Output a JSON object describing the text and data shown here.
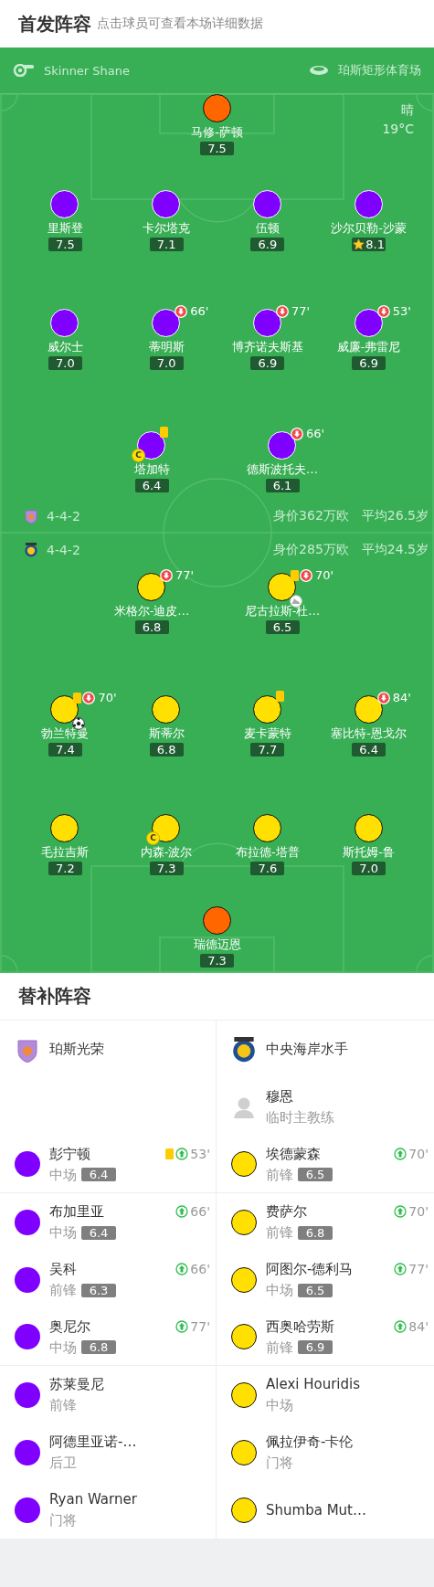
{
  "header": {
    "title": "首发阵容",
    "subtitle": "点击球员可查看本场详细数据"
  },
  "match": {
    "referee": "Skinner Shane",
    "venue": "珀斯矩形体育场",
    "weather": "晴",
    "temperature": "19°C"
  },
  "lineups": [
    {
      "formation": "4-4-2",
      "market_value": "身价362万欧",
      "average_age": "平均26.5岁",
      "lines": [
        [
          {
            "name": "马修-萨顿",
            "rating": "7.5",
            "color": "#ff6600",
            "best": false,
            "yellow_card": false,
            "goal": false,
            "assist": false
          }
        ],
        [
          {
            "name": "里斯登",
            "rating": "7.5",
            "color": "#8000ff",
            "best": false,
            "yellow_card": false,
            "goal": false,
            "assist": false
          },
          {
            "name": "卡尔塔克",
            "rating": "7.1",
            "color": "#8000ff",
            "best": false,
            "yellow_card": false,
            "goal": false,
            "assist": false
          },
          {
            "name": "伍顿",
            "rating": "6.9",
            "color": "#8000ff",
            "best": false,
            "yellow_card": false,
            "goal": false,
            "assist": false
          },
          {
            "name": "沙尔贝勒-沙蒙",
            "rating": "8.1",
            "color": "#8000ff",
            "best": true,
            "yellow_card": false,
            "goal": false,
            "assist": false
          }
        ],
        [
          {
            "name": "威尔士",
            "rating": "7.0",
            "color": "#8000ff",
            "best": false,
            "yellow_card": false,
            "goal": false,
            "assist": false
          },
          {
            "name": "蒂明斯",
            "rating": "7.0",
            "color": "#8000ff",
            "best": false,
            "yellow_card": false,
            "goal": false,
            "assist": false,
            "substituted_out": "66'"
          },
          {
            "name": "博齐诺夫斯基",
            "rating": "6.9",
            "color": "#8000ff",
            "best": false,
            "yellow_card": false,
            "goal": false,
            "assist": false,
            "substituted_out": "77'"
          },
          {
            "name": "威廉-弗雷尼",
            "rating": "6.9",
            "color": "#8000ff",
            "best": false,
            "yellow_card": false,
            "goal": false,
            "assist": false,
            "substituted_out": "53'"
          }
        ],
        [
          {
            "name": "塔加特",
            "rating": "6.4",
            "color": "#8000ff",
            "best": false,
            "yellow_card": true,
            "goal": false,
            "assist": false,
            "captain": "C"
          },
          {
            "name": "德斯波托夫…",
            "rating": "6.1",
            "color": "#8000ff",
            "best": false,
            "yellow_card": false,
            "goal": false,
            "assist": false,
            "substituted_out": "66'"
          }
        ]
      ]
    },
    {
      "formation": "4-4-2",
      "market_value": "身价285万欧",
      "average_age": "平均24.5岁",
      "lines": [
        [
          {
            "name": "米格尔-迪皮…",
            "rating": "6.8",
            "color": "#ffe000",
            "best": false,
            "yellow_card": false,
            "goal": false,
            "assist": false,
            "substituted_out": "77'"
          },
          {
            "name": "尼古拉斯-杜…",
            "rating": "6.5",
            "color": "#ffe000",
            "best": false,
            "yellow_card": true,
            "goal": false,
            "assist": true,
            "substituted_out": "70'"
          }
        ],
        [
          {
            "name": "勃兰特曼",
            "rating": "7.4",
            "color": "#ffe000",
            "best": false,
            "yellow_card": true,
            "goal": true,
            "assist": false,
            "substituted_out": "70'"
          },
          {
            "name": "斯蒂尔",
            "rating": "6.8",
            "color": "#ffe000",
            "best": false,
            "yellow_card": false,
            "goal": false,
            "assist": false
          },
          {
            "name": "麦卡蒙特",
            "rating": "7.7",
            "color": "#ffe000",
            "best": false,
            "yellow_card": true,
            "goal": false,
            "assist": false
          },
          {
            "name": "塞比特-恩戈尔",
            "rating": "6.4",
            "color": "#ffe000",
            "best": false,
            "yellow_card": false,
            "goal": false,
            "assist": false,
            "substituted_out": "84'"
          }
        ],
        [
          {
            "name": "毛拉吉斯",
            "rating": "7.2",
            "color": "#ffe000",
            "best": false,
            "yellow_card": false,
            "goal": false,
            "assist": false
          },
          {
            "name": "内森-波尔",
            "rating": "7.3",
            "color": "#ffe000",
            "best": false,
            "yellow_card": false,
            "goal": false,
            "assist": false,
            "captain": "C"
          },
          {
            "name": "布拉德-塔普",
            "rating": "7.6",
            "color": "#ffe000",
            "best": false,
            "yellow_card": false,
            "goal": false,
            "assist": false
          },
          {
            "name": "斯托姆-鲁",
            "rating": "7.0",
            "color": "#ffe000",
            "best": false,
            "yellow_card": false,
            "goal": false,
            "assist": false
          }
        ],
        [
          {
            "name": "瑞德迈恩",
            "rating": "7.3",
            "color": "#ff6600",
            "best": false,
            "yellow_card": false,
            "goal": false,
            "assist": false
          }
        ]
      ]
    }
  ],
  "bench": {
    "title": "替补阵容",
    "teams": [
      {
        "name": "珀斯光荣",
        "players": [
          {
            "name": "彭宁顿",
            "position": "中场",
            "rating": "6.4",
            "color": "#8000ff",
            "yellow_card": true,
            "substituted_in": "53'"
          },
          {
            "name": "布加里亚",
            "position": "中场",
            "rating": "6.4",
            "color": "#8000ff",
            "yellow_card": false,
            "substituted_in": "66'"
          },
          {
            "name": "吴科",
            "position": "前锋",
            "rating": "6.3",
            "color": "#8000ff",
            "yellow_card": false,
            "substituted_in": "66'"
          },
          {
            "name": "奥尼尔",
            "position": "中场",
            "rating": "6.8",
            "color": "#8000ff",
            "yellow_card": false,
            "substituted_in": "77'"
          },
          {
            "name": "苏莱曼尼",
            "position": "前锋",
            "color": "#8000ff",
            "yellow_card": false
          },
          {
            "name": "阿德里亚诺-…",
            "position": "后卫",
            "color": "#8000ff",
            "yellow_card": false
          },
          {
            "name": "Ryan Warner",
            "position": "门将",
            "color": "#8000ff",
            "yellow_card": false
          }
        ]
      },
      {
        "name": "中央海岸水手",
        "coach": {
          "name": "穆恩",
          "role": "临时主教练"
        },
        "players": [
          {
            "name": "埃德蒙森",
            "position": "前锋",
            "rating": "6.5",
            "color": "#ffe000",
            "yellow_card": false,
            "substituted_in": "70'"
          },
          {
            "name": "费萨尔",
            "position": "前锋",
            "rating": "6.8",
            "color": "#ffe000",
            "yellow_card": false,
            "substituted_in": "70'"
          },
          {
            "name": "阿图尔-德利马",
            "position": "中场",
            "rating": "6.5",
            "color": "#ffe000",
            "yellow_card": false,
            "substituted_in": "77'"
          },
          {
            "name": "西奥哈劳斯",
            "position": "前锋",
            "rating": "6.9",
            "color": "#ffe000",
            "yellow_card": false,
            "substituted_in": "84'"
          },
          {
            "name": "Alexi Houridis",
            "position": "中场",
            "color": "#ffe000",
            "yellow_card": false
          },
          {
            "name": "佩拉伊奇-卡伦",
            "position": "门将",
            "color": "#ffe000",
            "yellow_card": false
          },
          {
            "name": "Shumba Mut…",
            "color": "#ffe000",
            "yellow_card": false
          }
        ]
      }
    ]
  }
}
